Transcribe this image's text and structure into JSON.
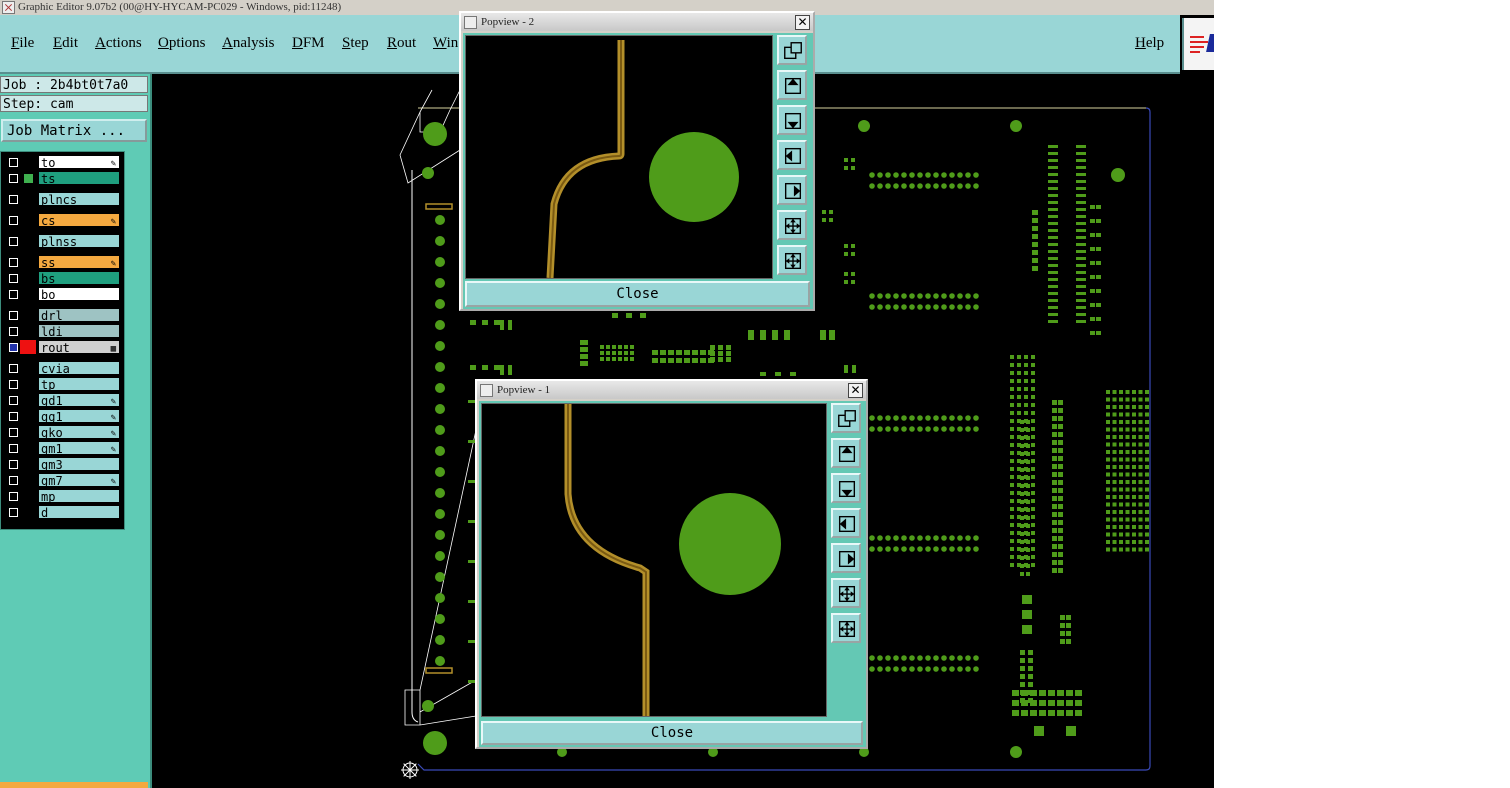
{
  "window": {
    "title": "Graphic Editor 9.07b2 (00@HY-HYCAM-PC029 - Windows, pid:11248)"
  },
  "menu": {
    "file": "File",
    "edit": "Edit",
    "actions": "Actions",
    "options": "Options",
    "analysis": "Analysis",
    "dfm": "DFM",
    "step": "Step",
    "rout": "Rout",
    "window": "Win",
    "help": "Help"
  },
  "job": {
    "label": "Job : 2b4bt0t7a0",
    "step": "Step: cam",
    "matrix_button": "Job Matrix ..."
  },
  "layers": [
    {
      "name": "to",
      "color": "#ffffff",
      "sw": "#000000",
      "editable": true
    },
    {
      "name": "ts",
      "color": "#1f9f7f",
      "sw": "#3fb04f",
      "editable": false
    },
    {
      "name": "plncs",
      "color": "#99d6d6",
      "sw": "#000000",
      "editable": false
    },
    {
      "name": "cs",
      "color": "#f4a940",
      "sw": "#000000",
      "editable": true
    },
    {
      "name": "plnss",
      "color": "#99d6d6",
      "sw": "#000000",
      "editable": false
    },
    {
      "name": "ss",
      "color": "#f4a940",
      "sw": "#000000",
      "editable": true
    },
    {
      "name": "bs",
      "color": "#1f9f7f",
      "sw": "#000000",
      "editable": false
    },
    {
      "name": "bo",
      "color": "#ffffff",
      "sw": "#000000",
      "editable": false
    },
    {
      "name": "drl",
      "color": "#9ec3c3",
      "sw": "#000000",
      "editable": false
    },
    {
      "name": "ldi",
      "color": "#9ec3c3",
      "sw": "#000000",
      "editable": false
    },
    {
      "name": "rout",
      "color": "#d0d0d0",
      "sw": "#ee1111",
      "editable": false,
      "selected": true
    },
    {
      "name": "cvia",
      "color": "#99d6d6",
      "sw": "#000000",
      "editable": false
    },
    {
      "name": "tp",
      "color": "#99d6d6",
      "sw": "#000000",
      "editable": false
    },
    {
      "name": "gd1",
      "color": "#99d6d6",
      "sw": "#000000",
      "editable": true
    },
    {
      "name": "gg1",
      "color": "#99d6d6",
      "sw": "#000000",
      "editable": true
    },
    {
      "name": "gko",
      "color": "#99d6d6",
      "sw": "#000000",
      "editable": true
    },
    {
      "name": "gm1",
      "color": "#99d6d6",
      "sw": "#000000",
      "editable": true
    },
    {
      "name": "gm3",
      "color": "#99d6d6",
      "sw": "#000000",
      "editable": false
    },
    {
      "name": "gm7",
      "color": "#99d6d6",
      "sw": "#000000",
      "editable": true
    },
    {
      "name": "mp",
      "color": "#99d6d6",
      "sw": "#000000",
      "editable": false
    },
    {
      "name": "d",
      "color": "#99d6d6",
      "sw": "#000000",
      "editable": false
    }
  ],
  "popup2": {
    "title": "Popview - 2",
    "close": "Close"
  },
  "popup1": {
    "title": "Popview - 1",
    "close": "Close"
  },
  "colors": {
    "pad": "#4f9c1a",
    "trace": "#b38f2a",
    "outline": "#3a4ab8",
    "menu": "#99d6d6",
    "panel": "#5fcbb5"
  }
}
